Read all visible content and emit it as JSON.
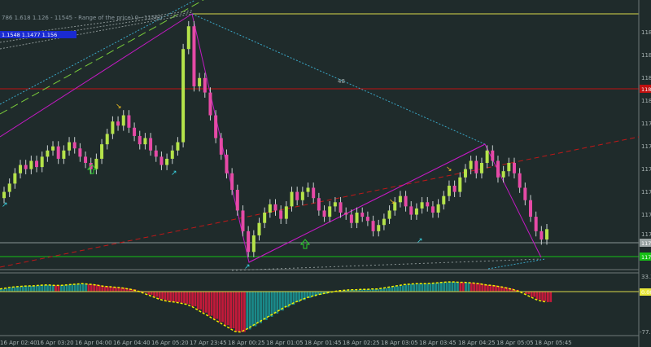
{
  "header": {
    "fib_text": "786 1.618 1.126 - 11545 - Range of the price) 0 - 11560",
    "blue_box_text": "1.1548 1.1477 1.156"
  },
  "colors": {
    "background": "#1f2b2b",
    "bull_candle": "#b5e34a",
    "bear_candle": "#e64aa6",
    "histo_teal": "#1a8a8a",
    "histo_red": "#c21a3a",
    "yellow": "#f0f000",
    "magenta": "#c21ac2",
    "red_line": "#c01010",
    "green_line": "#16c016",
    "cyan_dotted": "#3aa8c8"
  },
  "price_axis": {
    "labels": [
      "1184",
      "1182",
      "1181",
      "1180",
      "1179",
      "1178",
      "1177",
      "1176",
      "1175",
      "1174",
      "1173"
    ],
    "tag_red": "1181",
    "tag_gray": "1174",
    "tag_green": "1173",
    "osc_labels": [
      "33.2",
      "0.00",
      "-77.6"
    ]
  },
  "annotation_number": "48",
  "time_axis": [
    "16 Apr 02:40",
    "16 Apr 03:20",
    "16 Apr 04:00",
    "16 Apr 04:40",
    "16 Apr 05:20",
    "17 Apr 23:45",
    "18 Apr 00:25",
    "18 Apr 01:05",
    "18 Apr 01:45",
    "18 Apr 02:25",
    "18 Apr 03:05",
    "18 Apr 03:45",
    "18 Apr 04:25",
    "18 Apr 05:05",
    "18 Apr 05:45"
  ],
  "chart_data": {
    "type": "candlestick",
    "closes": [
      1175.9,
      1176.3,
      1176.8,
      1177.2,
      1177.0,
      1177.4,
      1177.1,
      1177.6,
      1177.9,
      1178.1,
      1177.5,
      1177.9,
      1178.3,
      1178.0,
      1177.6,
      1177.3,
      1177.0,
      1177.5,
      1178.2,
      1178.7,
      1179.3,
      1179.1,
      1179.6,
      1179.0,
      1178.6,
      1178.2,
      1178.5,
      1177.9,
      1177.6,
      1177.2,
      1177.5,
      1177.9,
      1178.3,
      1182.8,
      1183.9,
      1181.0,
      1181.4,
      1180.7,
      1179.6,
      1178.5,
      1177.7,
      1176.8,
      1176.0,
      1175.0,
      1174.0,
      1173.0,
      1173.8,
      1174.4,
      1174.9,
      1175.3,
      1175.0,
      1174.6,
      1175.2,
      1175.9,
      1175.5,
      1175.9,
      1176.1,
      1175.6,
      1175.0,
      1174.7,
      1175.2,
      1175.4,
      1174.9,
      1174.8,
      1174.4,
      1174.9,
      1174.7,
      1174.5,
      1174.0,
      1174.3,
      1174.6,
      1175.0,
      1175.4,
      1175.7,
      1175.2,
      1174.8,
      1175.1,
      1175.4,
      1175.2,
      1174.9,
      1175.3,
      1175.7,
      1176.2,
      1175.9,
      1176.6,
      1177.0,
      1177.4,
      1176.8,
      1177.3,
      1177.9,
      1177.4,
      1176.6,
      1176.9,
      1177.3,
      1176.8,
      1176.1,
      1175.5,
      1174.7,
      1174.0,
      1173.6,
      1174.1
    ],
    "oscillator": [
      6,
      8,
      10,
      11,
      12,
      13,
      13,
      14,
      15,
      15,
      14,
      14,
      15,
      16,
      17,
      18,
      17,
      16,
      14,
      12,
      11,
      10,
      9,
      7,
      5,
      2,
      -2,
      -6,
      -10,
      -14,
      -17,
      -19,
      -20,
      -22,
      -24,
      -28,
      -34,
      -40,
      -46,
      -52,
      -58,
      -64,
      -70,
      -76,
      -77,
      -72,
      -66,
      -60,
      -54,
      -48,
      -42,
      -36,
      -30,
      -25,
      -20,
      -16,
      -12,
      -9,
      -6,
      -4,
      -2,
      0,
      2,
      3,
      4,
      4,
      5,
      5,
      6,
      6,
      8,
      10,
      12,
      14,
      16,
      17,
      18,
      18,
      18,
      19,
      20,
      21,
      22,
      22,
      21,
      21,
      20,
      19,
      17,
      15,
      14,
      12,
      10,
      7,
      4,
      0,
      -5,
      -10,
      -15,
      -18,
      -20
    ]
  }
}
